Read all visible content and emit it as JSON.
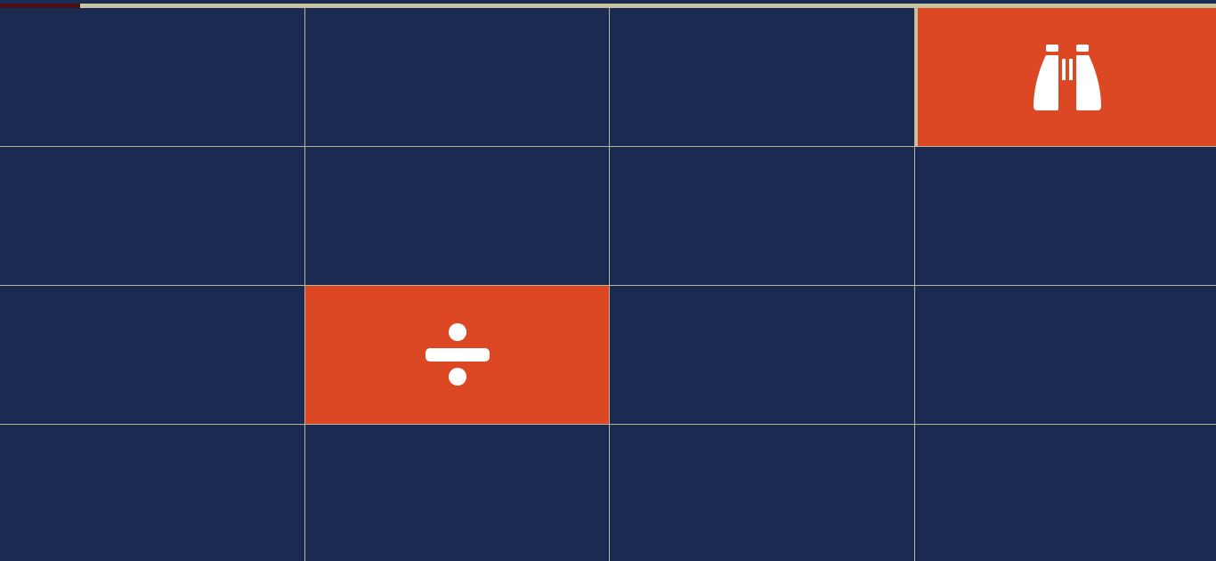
{
  "game": {
    "type": "memory-match",
    "progress_fraction": 0.066,
    "colors": {
      "board": "#1a2a50",
      "tile_revealed": "#dc4724",
      "grid_line": "#b9b69a",
      "progress_track": "#c8c4a0",
      "progress_fill": "#4a0f14",
      "icon": "#ffffff"
    },
    "grid": {
      "rows": 4,
      "cols": 4
    },
    "tiles": [
      {
        "row": 0,
        "col": 0,
        "state": "hidden"
      },
      {
        "row": 0,
        "col": 1,
        "state": "hidden"
      },
      {
        "row": 0,
        "col": 2,
        "state": "hidden"
      },
      {
        "row": 0,
        "col": 3,
        "state": "revealed",
        "icon": "binoculars-icon",
        "selected": true
      },
      {
        "row": 1,
        "col": 0,
        "state": "hidden"
      },
      {
        "row": 1,
        "col": 1,
        "state": "hidden"
      },
      {
        "row": 1,
        "col": 2,
        "state": "hidden"
      },
      {
        "row": 1,
        "col": 3,
        "state": "hidden"
      },
      {
        "row": 2,
        "col": 0,
        "state": "hidden"
      },
      {
        "row": 2,
        "col": 1,
        "state": "revealed",
        "icon": "divide-icon"
      },
      {
        "row": 2,
        "col": 2,
        "state": "hidden"
      },
      {
        "row": 2,
        "col": 3,
        "state": "hidden"
      },
      {
        "row": 3,
        "col": 0,
        "state": "hidden"
      },
      {
        "row": 3,
        "col": 1,
        "state": "hidden"
      },
      {
        "row": 3,
        "col": 2,
        "state": "hidden"
      },
      {
        "row": 3,
        "col": 3,
        "state": "hidden"
      }
    ]
  }
}
